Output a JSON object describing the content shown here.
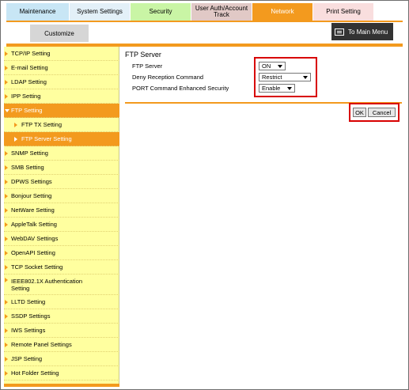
{
  "tabs": [
    {
      "label": "Maintenance"
    },
    {
      "label": "System Settings"
    },
    {
      "label": "Security"
    },
    {
      "label": "User Auth/Account Track"
    },
    {
      "label": "Network"
    },
    {
      "label": "Print Setting"
    }
  ],
  "customize_label": "Customize",
  "main_menu_label": "To Main Menu",
  "sidebar": {
    "items": [
      {
        "label": "TCP/IP Setting"
      },
      {
        "label": "E-mail Setting"
      },
      {
        "label": "LDAP Setting"
      },
      {
        "label": "IPP Setting"
      },
      {
        "label": "FTP Setting"
      },
      {
        "label": "FTP TX Setting"
      },
      {
        "label": "FTP Server Setting"
      },
      {
        "label": "SNMP Setting"
      },
      {
        "label": "SMB Setting"
      },
      {
        "label": "DPWS Settings"
      },
      {
        "label": "Bonjour Setting"
      },
      {
        "label": "NetWare Setting"
      },
      {
        "label": "AppleTalk Setting"
      },
      {
        "label": "WebDAV Settings"
      },
      {
        "label": "OpenAPI Setting"
      },
      {
        "label": "TCP Socket Setting"
      },
      {
        "label": "IEEE802.1X Authentication Setting"
      },
      {
        "label": "LLTD Setting"
      },
      {
        "label": "SSDP Settings"
      },
      {
        "label": "IWS Settings"
      },
      {
        "label": "Remote Panel Settings"
      },
      {
        "label": "JSP Setting"
      },
      {
        "label": "Hot Folder Setting"
      }
    ]
  },
  "main": {
    "title": "FTP Server",
    "fields": [
      {
        "label": "FTP Server",
        "value": "ON"
      },
      {
        "label": "Deny Reception Command",
        "value": "Restrict"
      },
      {
        "label": "PORT Command Enhanced Security",
        "value": "Enable"
      }
    ],
    "ok_label": "OK",
    "cancel_label": "Cancel"
  },
  "colors": {
    "accent": "#f39a1e",
    "sidebar_bg": "#ffff9f",
    "highlight": "#d80000"
  }
}
